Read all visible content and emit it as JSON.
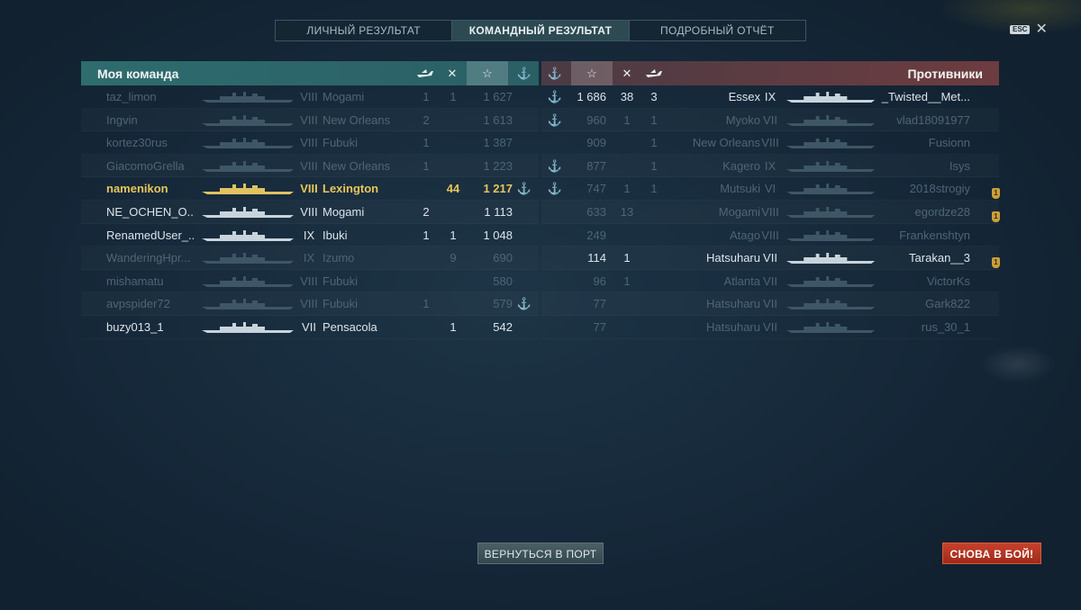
{
  "tabs": [
    {
      "label": "ЛИЧНЫЙ РЕЗУЛЬТАТ",
      "active": false
    },
    {
      "label": "КОМАНДНЫЙ РЕЗУЛЬТАТ",
      "active": true
    },
    {
      "label": "ПОДРОБНЫЙ ОТЧЁТ",
      "active": false
    }
  ],
  "esc_label": "ESC",
  "close_glyph": "✕",
  "my_team": {
    "title": "Моя команда",
    "header_icons": [
      "plane-icon",
      "crossed-swords-icon",
      "star-icon",
      "anchor-icon"
    ],
    "rows": [
      {
        "player": "taz_limon",
        "tier": "VIII",
        "ship": "Mogami",
        "c1": "1",
        "c2": "1",
        "score": "1 627",
        "anchor": "",
        "state": "dead"
      },
      {
        "player": "Ingvin",
        "tier": "VIII",
        "ship": "New Orleans",
        "c1": "2",
        "c2": "",
        "score": "1 613",
        "anchor": "",
        "state": "dead"
      },
      {
        "player": "kortez30rus",
        "tier": "VIII",
        "ship": "Fubuki",
        "c1": "1",
        "c2": "",
        "score": "1 387",
        "anchor": "",
        "state": "dead"
      },
      {
        "player": "GiacomoGrella",
        "tier": "VIII",
        "ship": "New Orleans",
        "c1": "1",
        "c2": "",
        "score": "1 223",
        "anchor": "",
        "state": "dead"
      },
      {
        "player": "namenikon",
        "tier": "VIII",
        "ship": "Lexington",
        "c1": "",
        "c2": "44",
        "score": "1 217",
        "anchor": "⚓",
        "state": "me"
      },
      {
        "player": "NE_OCHEN_O...",
        "tier": "VIII",
        "ship": "Mogami",
        "c1": "2",
        "c2": "",
        "score": "1 113",
        "anchor": "",
        "state": "alive"
      },
      {
        "player": "RenamedUser_...",
        "tier": "IX",
        "ship": "Ibuki",
        "c1": "1",
        "c2": "1",
        "score": "1 048",
        "anchor": "",
        "state": "alive"
      },
      {
        "player": "WanderingHpr...",
        "tier": "IX",
        "ship": "Izumo",
        "c1": "",
        "c2": "9",
        "score": "690",
        "anchor": "",
        "state": "dead"
      },
      {
        "player": "mishamatu",
        "tier": "VIII",
        "ship": "Fubuki",
        "c1": "",
        "c2": "",
        "score": "580",
        "anchor": "",
        "state": "dead"
      },
      {
        "player": "avpspider72",
        "tier": "VIII",
        "ship": "Fubuki",
        "c1": "1",
        "c2": "",
        "score": "579",
        "anchor": "⚓",
        "state": "dead"
      },
      {
        "player": "buzy013_1",
        "tier": "VII",
        "ship": "Pensacola",
        "c1": "",
        "c2": "1",
        "score": "542",
        "anchor": "",
        "state": "alive"
      }
    ]
  },
  "enemy_team": {
    "title": "Противники",
    "header_icons": [
      "anchor-icon",
      "star-icon",
      "crossed-swords-icon",
      "plane-icon"
    ],
    "rows": [
      {
        "anchor": "⚓",
        "score": "1 686",
        "c1": "38",
        "c2": "3",
        "ship": "Essex",
        "tier": "IX",
        "player": "_Twisted__Met...",
        "badge": "",
        "state": "alive"
      },
      {
        "anchor": "⚓",
        "score": "960",
        "c1": "1",
        "c2": "1",
        "ship": "Myoko",
        "tier": "VII",
        "player": "vlad18091977",
        "badge": "",
        "state": "dead"
      },
      {
        "anchor": "",
        "score": "909",
        "c1": "",
        "c2": "1",
        "ship": "New Orleans",
        "tier": "VIII",
        "player": "Fusionn",
        "badge": "",
        "state": "dead"
      },
      {
        "anchor": "⚓",
        "score": "877",
        "c1": "",
        "c2": "1",
        "ship": "Kagero",
        "tier": "IX",
        "player": "Isys",
        "badge": "",
        "state": "dead"
      },
      {
        "anchor": "⚓",
        "score": "747",
        "c1": "1",
        "c2": "1",
        "ship": "Mutsuki",
        "tier": "VI",
        "player": "2018strogiy",
        "badge": "1",
        "state": "dead"
      },
      {
        "anchor": "",
        "score": "633",
        "c1": "13",
        "c2": "",
        "ship": "Mogami",
        "tier": "VIII",
        "player": "egordze28",
        "badge": "1",
        "state": "dead"
      },
      {
        "anchor": "",
        "score": "249",
        "c1": "",
        "c2": "",
        "ship": "Atago",
        "tier": "VIII",
        "player": "Frankenshtyn",
        "badge": "",
        "state": "dead"
      },
      {
        "anchor": "",
        "score": "114",
        "c1": "1",
        "c2": "",
        "ship": "Hatsuharu",
        "tier": "VII",
        "player": "Tarakan__3",
        "badge": "1",
        "state": "alive"
      },
      {
        "anchor": "",
        "score": "96",
        "c1": "1",
        "c2": "",
        "ship": "Atlanta",
        "tier": "VII",
        "player": "VictorKs",
        "badge": "",
        "state": "dead"
      },
      {
        "anchor": "",
        "score": "77",
        "c1": "",
        "c2": "",
        "ship": "Hatsuharu",
        "tier": "VII",
        "player": "Gark822",
        "badge": "",
        "state": "dead"
      },
      {
        "anchor": "",
        "score": "77",
        "c1": "",
        "c2": "",
        "ship": "Hatsuharu",
        "tier": "VII",
        "player": "rus_30_1",
        "badge": "",
        "state": "dead"
      }
    ]
  },
  "buttons": {
    "return_port": "ВЕРНУТЬСЯ В ПОРТ",
    "battle_again": "СНОВА В БОЙ!"
  },
  "colors": {
    "my_header": "#2e6c6e",
    "enemy_header": "#6d3c40",
    "self_highlight": "#e8c65a",
    "battle_button": "#c8412c"
  }
}
